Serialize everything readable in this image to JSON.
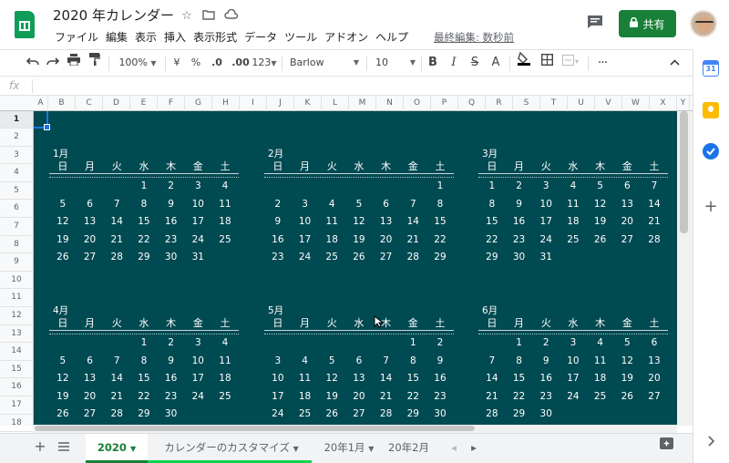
{
  "doc": {
    "title": "2020 年カレンダー",
    "last_edit": "最終編集: 数秒前"
  },
  "menu": [
    "ファイル",
    "編集",
    "表示",
    "挿入",
    "表示形式",
    "データ",
    "ツール",
    "アドオン",
    "ヘルプ"
  ],
  "share_label": "共有",
  "toolbar": {
    "zoom": "100%",
    "currency": "¥",
    "percent": "%",
    "dec_less": ".0",
    "dec_more": ".00",
    "format_more": "123",
    "font": "Barlow",
    "font_size": "10",
    "bold": "B",
    "italic": "I",
    "strike": "S",
    "text_color": "A"
  },
  "formula": {
    "fx": "fx",
    "value": ""
  },
  "columns": [
    "A",
    "B",
    "C",
    "D",
    "E",
    "F",
    "G",
    "H",
    "I",
    "J",
    "K",
    "L",
    "M",
    "N",
    "O",
    "P",
    "Q",
    "R",
    "S",
    "T",
    "U",
    "V",
    "W",
    "X",
    "Y"
  ],
  "rows": [
    "1",
    "2",
    "3",
    "4",
    "5",
    "6",
    "7",
    "8",
    "9",
    "10",
    "11",
    "12",
    "13",
    "14",
    "15",
    "16",
    "17",
    "18"
  ],
  "calendar": {
    "dow": [
      "日",
      "月",
      "火",
      "水",
      "木",
      "金",
      "土"
    ],
    "months": [
      {
        "label": "1月",
        "weeks": [
          [
            "",
            "",
            "",
            "1",
            "2",
            "3",
            "4"
          ],
          [
            "5",
            "6",
            "7",
            "8",
            "9",
            "10",
            "11"
          ],
          [
            "12",
            "13",
            "14",
            "15",
            "16",
            "17",
            "18"
          ],
          [
            "19",
            "20",
            "21",
            "22",
            "23",
            "24",
            "25"
          ],
          [
            "26",
            "27",
            "28",
            "29",
            "30",
            "31",
            ""
          ]
        ]
      },
      {
        "label": "2月",
        "weeks": [
          [
            "",
            "",
            "",
            "",
            "",
            "",
            "1"
          ],
          [
            "2",
            "3",
            "4",
            "5",
            "6",
            "7",
            "8"
          ],
          [
            "9",
            "10",
            "11",
            "12",
            "13",
            "14",
            "15"
          ],
          [
            "16",
            "17",
            "18",
            "19",
            "20",
            "21",
            "22"
          ],
          [
            "23",
            "24",
            "25",
            "26",
            "27",
            "28",
            "29"
          ]
        ]
      },
      {
        "label": "3月",
        "weeks": [
          [
            "1",
            "2",
            "3",
            "4",
            "5",
            "6",
            "7"
          ],
          [
            "8",
            "9",
            "10",
            "11",
            "12",
            "13",
            "14"
          ],
          [
            "15",
            "16",
            "17",
            "18",
            "19",
            "20",
            "21"
          ],
          [
            "22",
            "23",
            "24",
            "25",
            "26",
            "27",
            "28"
          ],
          [
            "29",
            "30",
            "31",
            "",
            "",
            "",
            ""
          ]
        ]
      },
      {
        "label": "4月",
        "weeks": [
          [
            "",
            "",
            "",
            "1",
            "2",
            "3",
            "4"
          ],
          [
            "5",
            "6",
            "7",
            "8",
            "9",
            "10",
            "11"
          ],
          [
            "12",
            "13",
            "14",
            "15",
            "16",
            "17",
            "18"
          ],
          [
            "19",
            "20",
            "21",
            "22",
            "23",
            "24",
            "25"
          ],
          [
            "26",
            "27",
            "28",
            "29",
            "30",
            "",
            ""
          ]
        ]
      },
      {
        "label": "5月",
        "weeks": [
          [
            "",
            "",
            "",
            "",
            "",
            "1",
            "2"
          ],
          [
            "3",
            "4",
            "5",
            "6",
            "7",
            "8",
            "9"
          ],
          [
            "10",
            "11",
            "12",
            "13",
            "14",
            "15",
            "16"
          ],
          [
            "17",
            "18",
            "19",
            "20",
            "21",
            "22",
            "23"
          ],
          [
            "24",
            "25",
            "26",
            "27",
            "28",
            "29",
            "30"
          ]
        ]
      },
      {
        "label": "6月",
        "weeks": [
          [
            "",
            "1",
            "2",
            "3",
            "4",
            "5",
            "6"
          ],
          [
            "7",
            "8",
            "9",
            "10",
            "11",
            "12",
            "13"
          ],
          [
            "14",
            "15",
            "16",
            "17",
            "18",
            "19",
            "20"
          ],
          [
            "21",
            "22",
            "23",
            "24",
            "25",
            "26",
            "27"
          ],
          [
            "28",
            "29",
            "30",
            "",
            "",
            "",
            ""
          ]
        ]
      }
    ]
  },
  "sheet_tabs": [
    "2020",
    "カレンダーのカスタマイズ",
    "20年1月",
    "20年2月"
  ],
  "colors": {
    "sheet_bg": "#004a52",
    "accent": "#188038"
  },
  "icons": [
    "star-icon",
    "move-to-folder-icon",
    "cloud-saved-icon",
    "comment-icon",
    "lock-icon",
    "undo-icon",
    "redo-icon",
    "print-icon",
    "paint-format-icon",
    "fill-color-icon",
    "borders-icon",
    "merge-cells-icon",
    "more-icon",
    "collapse-icon",
    "add-sheet-icon",
    "all-sheets-icon",
    "explore-icon",
    "calendar-icon",
    "keep-icon",
    "tasks-icon",
    "add-icon",
    "expand-panel-icon"
  ]
}
